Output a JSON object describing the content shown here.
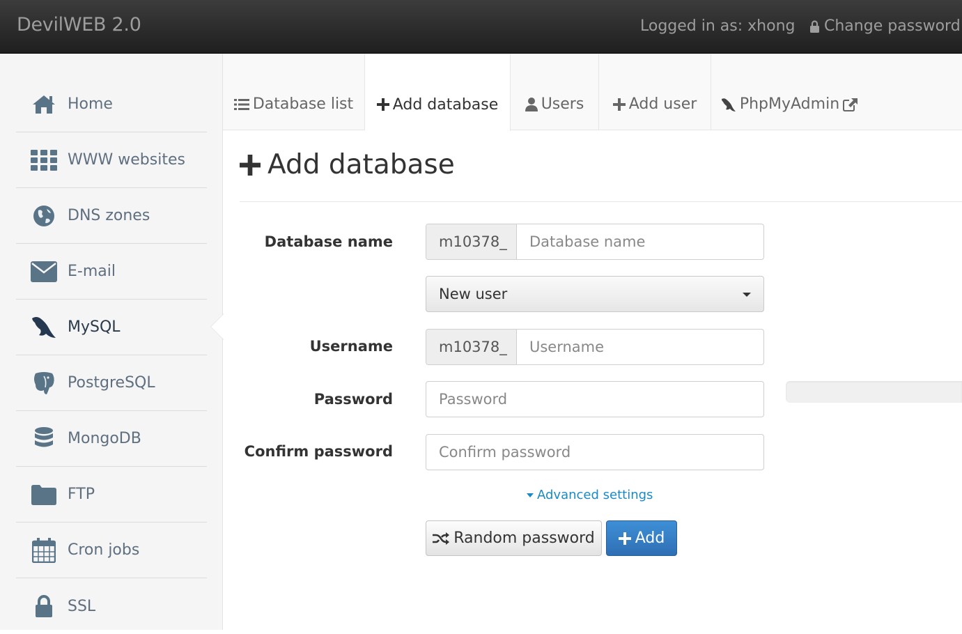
{
  "header": {
    "brand": "DevilWEB 2.0",
    "logged_in": "Logged in as: xhong",
    "change_password": "Change password"
  },
  "sidebar": {
    "items": [
      {
        "label": "Home",
        "icon": "home-icon"
      },
      {
        "label": "WWW websites",
        "icon": "grid-icon"
      },
      {
        "label": "DNS zones",
        "icon": "globe-icon"
      },
      {
        "label": "E-mail",
        "icon": "envelope-icon"
      },
      {
        "label": "MySQL",
        "icon": "dolphin-icon",
        "active": true
      },
      {
        "label": "PostgreSQL",
        "icon": "elephant-icon"
      },
      {
        "label": "MongoDB",
        "icon": "database-icon"
      },
      {
        "label": "FTP",
        "icon": "folder-icon"
      },
      {
        "label": "Cron jobs",
        "icon": "calendar-icon"
      },
      {
        "label": "SSL",
        "icon": "lock-icon"
      }
    ]
  },
  "tabs": [
    {
      "label": "Database list",
      "icon": "list-icon"
    },
    {
      "label": "Add database",
      "icon": "plus-icon",
      "active": true
    },
    {
      "label": "Users",
      "icon": "user-icon"
    },
    {
      "label": "Add user",
      "icon": "plus-icon"
    },
    {
      "label": "PhpMyAdmin",
      "icon": "dolphin-icon"
    }
  ],
  "page": {
    "title": "Add database"
  },
  "form": {
    "db_name_label": "Database name",
    "db_prefix": "m10378_",
    "db_name_placeholder": "Database name",
    "user_select": "New user",
    "username_label": "Username",
    "user_prefix": "m10378_",
    "username_placeholder": "Username",
    "password_label": "Password",
    "password_placeholder": "Password",
    "confirm_label": "Confirm password",
    "confirm_placeholder": "Confirm password",
    "advanced": "Advanced settings",
    "random_btn": "Random password",
    "add_btn": "Add"
  },
  "colors": {
    "primary": "#3079c4",
    "link": "#1a8ac6",
    "sidebar_text": "#5f6f7f"
  }
}
